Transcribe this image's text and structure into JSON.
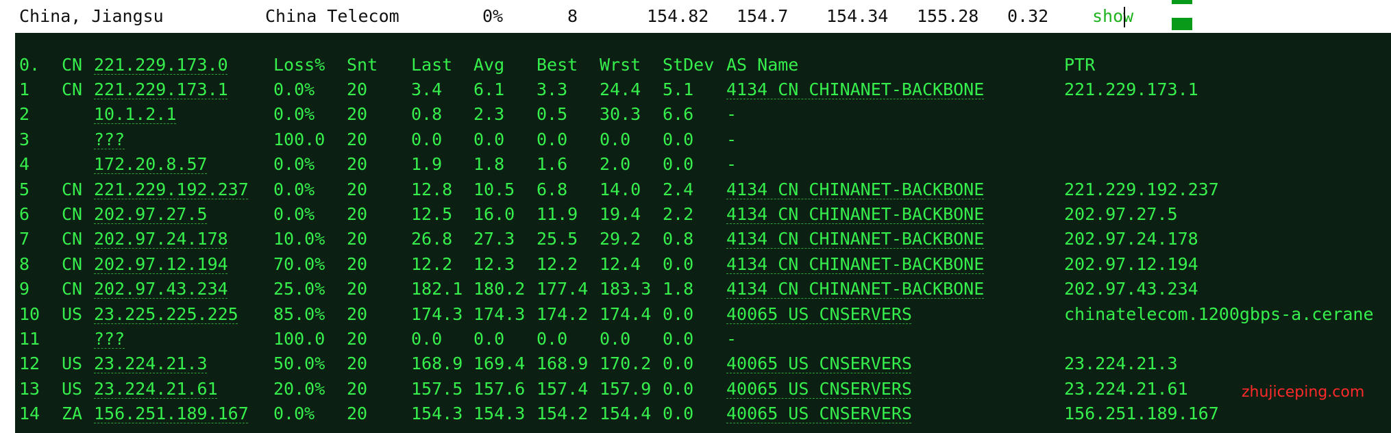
{
  "summary_row": {
    "location": "China, Jiangsu",
    "isp": "China Telecom",
    "loss": "0%",
    "sent": "8",
    "last": "154.82",
    "avg": "154.7",
    "best": "154.34",
    "worst": "155.28",
    "stdev": "0.32",
    "action": "show"
  },
  "header": {
    "hop": "0.",
    "cc": "CN",
    "host": "221.229.173.0",
    "loss": "Loss%",
    "snt": "Snt",
    "last": "Last",
    "avg": "Avg",
    "best": "Best",
    "wrst": "Wrst",
    "stdev": "StDev",
    "asname": "AS Name",
    "ptr": "PTR"
  },
  "hops": [
    {
      "hop": "1",
      "cc": "CN",
      "host": "221.229.173.1",
      "loss": "0.0%",
      "snt": "20",
      "last": "3.4",
      "avg": "6.1",
      "best": "3.3",
      "wrst": "24.4",
      "stdev": "5.1",
      "asname": "4134  CN CHINANET-BACKBONE",
      "ptr": "221.229.173.1"
    },
    {
      "hop": "2",
      "cc": "",
      "host": "10.1.2.1",
      "loss": "0.0%",
      "snt": "20",
      "last": "0.8",
      "avg": "2.3",
      "best": "0.5",
      "wrst": "30.3",
      "stdev": "6.6",
      "asname": "-",
      "ptr": ""
    },
    {
      "hop": "3",
      "cc": "",
      "host": "???",
      "loss": "100.0",
      "snt": "20",
      "last": "0.0",
      "avg": "0.0",
      "best": "0.0",
      "wrst": "0.0",
      "stdev": "0.0",
      "asname": "-",
      "ptr": ""
    },
    {
      "hop": "4",
      "cc": "",
      "host": "172.20.8.57",
      "loss": "0.0%",
      "snt": "20",
      "last": "1.9",
      "avg": "1.8",
      "best": "1.6",
      "wrst": "2.0",
      "stdev": "0.0",
      "asname": "-",
      "ptr": ""
    },
    {
      "hop": "5",
      "cc": "CN",
      "host": "221.229.192.237",
      "loss": "0.0%",
      "snt": "20",
      "last": "12.8",
      "avg": "10.5",
      "best": "6.8",
      "wrst": "14.0",
      "stdev": "2.4",
      "asname": "4134  CN CHINANET-BACKBONE",
      "ptr": "221.229.192.237"
    },
    {
      "hop": "6",
      "cc": "CN",
      "host": "202.97.27.5",
      "loss": "0.0%",
      "snt": "20",
      "last": "12.5",
      "avg": "16.0",
      "best": "11.9",
      "wrst": "19.4",
      "stdev": "2.2",
      "asname": "4134  CN CHINANET-BACKBONE",
      "ptr": "202.97.27.5"
    },
    {
      "hop": "7",
      "cc": "CN",
      "host": "202.97.24.178",
      "loss": "10.0%",
      "snt": "20",
      "last": "26.8",
      "avg": "27.3",
      "best": "25.5",
      "wrst": "29.2",
      "stdev": "0.8",
      "asname": "4134  CN CHINANET-BACKBONE",
      "ptr": "202.97.24.178"
    },
    {
      "hop": "8",
      "cc": "CN",
      "host": "202.97.12.194",
      "loss": "70.0%",
      "snt": "20",
      "last": "12.2",
      "avg": "12.3",
      "best": "12.2",
      "wrst": "12.4",
      "stdev": "0.0",
      "asname": "4134  CN CHINANET-BACKBONE",
      "ptr": "202.97.12.194"
    },
    {
      "hop": "9",
      "cc": "CN",
      "host": "202.97.43.234",
      "loss": "25.0%",
      "snt": "20",
      "last": "182.1",
      "avg": "180.2",
      "best": "177.4",
      "wrst": "183.3",
      "stdev": "1.8",
      "asname": "4134  CN CHINANET-BACKBONE",
      "ptr": "202.97.43.234"
    },
    {
      "hop": "10",
      "cc": "US",
      "host": "23.225.225.225",
      "loss": "85.0%",
      "snt": "20",
      "last": "174.3",
      "avg": "174.3",
      "best": "174.2",
      "wrst": "174.4",
      "stdev": "0.0",
      "asname": "40065 US CNSERVERS",
      "ptr": "chinatelecom.1200gbps-a.cerane"
    },
    {
      "hop": "11",
      "cc": "",
      "host": "???",
      "loss": "100.0",
      "snt": "20",
      "last": "0.0",
      "avg": "0.0",
      "best": "0.0",
      "wrst": "0.0",
      "stdev": "0.0",
      "asname": "-",
      "ptr": ""
    },
    {
      "hop": "12",
      "cc": "US",
      "host": "23.224.21.3",
      "loss": "50.0%",
      "snt": "20",
      "last": "168.9",
      "avg": "169.4",
      "best": "168.9",
      "wrst": "170.2",
      "stdev": "0.0",
      "asname": "40065 US CNSERVERS",
      "ptr": "23.224.21.3"
    },
    {
      "hop": "13",
      "cc": "US",
      "host": "23.224.21.61",
      "loss": "20.0%",
      "snt": "20",
      "last": "157.5",
      "avg": "157.6",
      "best": "157.4",
      "wrst": "157.9",
      "stdev": "0.0",
      "asname": "40065 US CNSERVERS",
      "ptr": "23.224.21.61"
    },
    {
      "hop": "14",
      "cc": "ZA",
      "host": "156.251.189.167",
      "loss": "0.0%",
      "snt": "20",
      "last": "154.3",
      "avg": "154.3",
      "best": "154.2",
      "wrst": "154.4",
      "stdev": "0.0",
      "asname": "40065 US CNSERVERS",
      "ptr": "156.251.189.167"
    }
  ],
  "watermark": "zhujiceping.com",
  "colors": {
    "terminal_bg": "#0b1f12",
    "terminal_text": "#36ef4d",
    "accent_green": "#0a9a1a",
    "watermark": "#ff2a2a"
  }
}
